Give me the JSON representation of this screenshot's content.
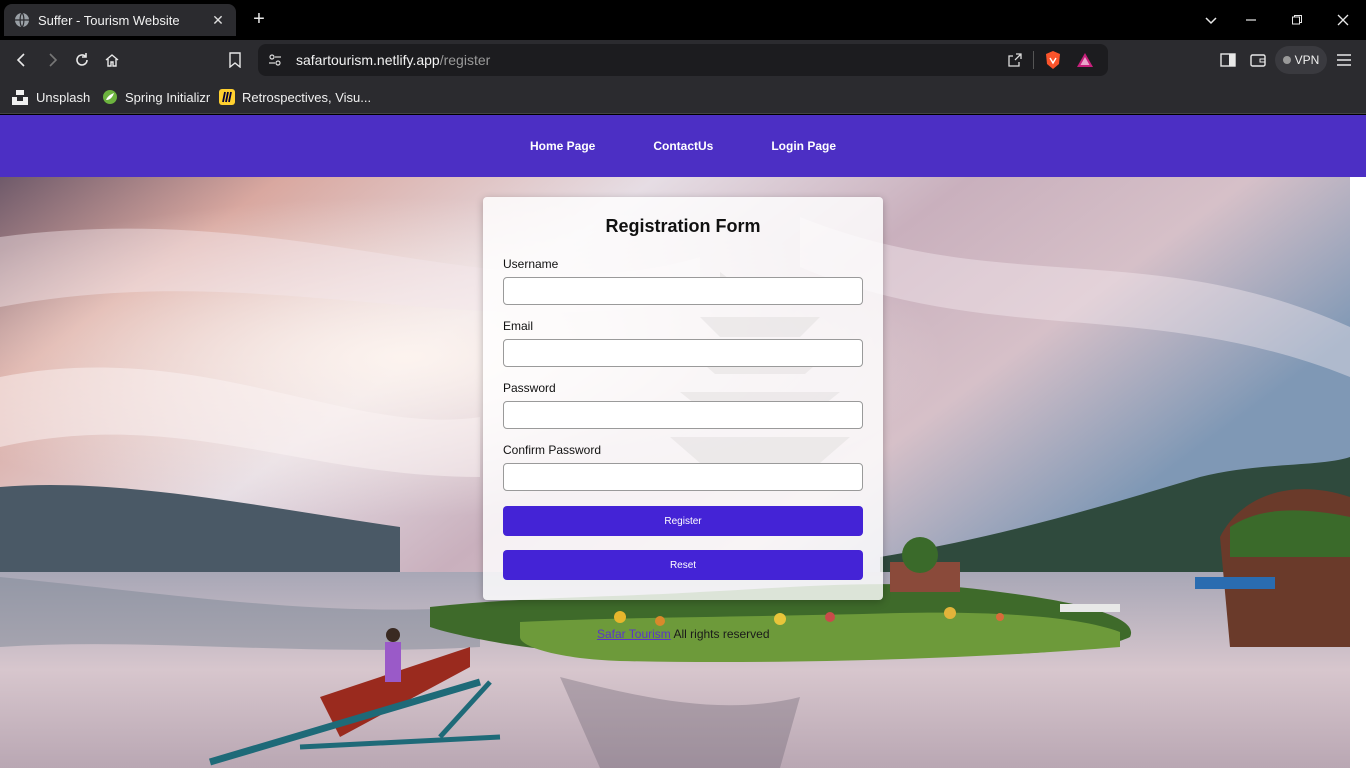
{
  "browser": {
    "tab_title": "Suffer - Tourism Website",
    "url_host": "safartourism.netlify.app",
    "url_path": "/register",
    "vpn_label": "VPN",
    "bookmarks": [
      {
        "label": "Unsplash",
        "icon": "unsplash-icon"
      },
      {
        "label": "Spring Initializr",
        "icon": "spring-icon"
      },
      {
        "label": "Retrospectives, Visu...",
        "icon": "miro-icon"
      }
    ]
  },
  "nav": {
    "links": [
      "Home Page",
      "ContactUs",
      "Login Page"
    ],
    "color": "#4c2fc4"
  },
  "form": {
    "title": "Registration Form",
    "fields": [
      {
        "label": "Username",
        "value": ""
      },
      {
        "label": "Email",
        "value": ""
      },
      {
        "label": "Password",
        "value": ""
      },
      {
        "label": "Confirm Password",
        "value": ""
      }
    ],
    "register_label": "Register",
    "reset_label": "Reset",
    "button_color": "#4423d6"
  },
  "footer": {
    "brand": "Safar Tourism",
    "rest": " All rights reserved"
  }
}
